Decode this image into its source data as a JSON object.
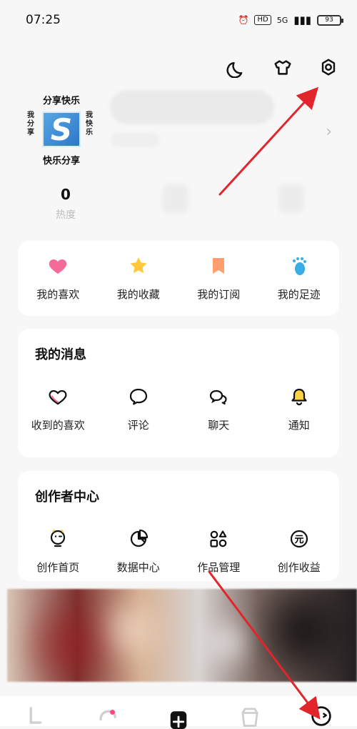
{
  "status_bar": {
    "time": "07:25",
    "hd": "HD",
    "network": "5G",
    "battery": "93"
  },
  "top_actions": {
    "dark_mode_icon": "moon-icon",
    "theme_icon": "shirt-icon",
    "settings_icon": "gear-icon"
  },
  "profile": {
    "logo_top": "分享快乐",
    "logo_left": "我分享",
    "logo_right": "我快乐",
    "logo_center": "S",
    "logo_bottom": "快乐分享",
    "heat_value": "0",
    "heat_label": "热度"
  },
  "quick_actions": [
    {
      "label": "我的喜欢",
      "icon": "heart-icon",
      "color": "#f46b98"
    },
    {
      "label": "我的收藏",
      "icon": "star-icon",
      "color": "#ffc83d"
    },
    {
      "label": "我的订阅",
      "icon": "bookmark-icon",
      "color": "#ff9f6e"
    },
    {
      "label": "我的足迹",
      "icon": "footprint-icon",
      "color": "#37aee8"
    }
  ],
  "messages": {
    "title": "我的消息",
    "items": [
      {
        "label": "收到的喜欢",
        "icon": "heart-outline-icon"
      },
      {
        "label": "评论",
        "icon": "comment-icon"
      },
      {
        "label": "聊天",
        "icon": "chat-icon"
      },
      {
        "label": "通知",
        "icon": "bell-icon"
      }
    ]
  },
  "creator": {
    "title": "创作者中心",
    "items": [
      {
        "label": "创作首页",
        "icon": "creator-home-icon"
      },
      {
        "label": "数据中心",
        "icon": "data-center-icon"
      },
      {
        "label": "作品管理",
        "icon": "works-management-icon"
      },
      {
        "label": "创作收益",
        "icon": "earnings-icon"
      }
    ]
  },
  "colors": {
    "accent_red": "#e1252b",
    "icon_yellow": "#ffc83d",
    "icon_blue": "#37aee8",
    "icon_orange": "#ff9f6e",
    "icon_pink": "#f46b98"
  }
}
